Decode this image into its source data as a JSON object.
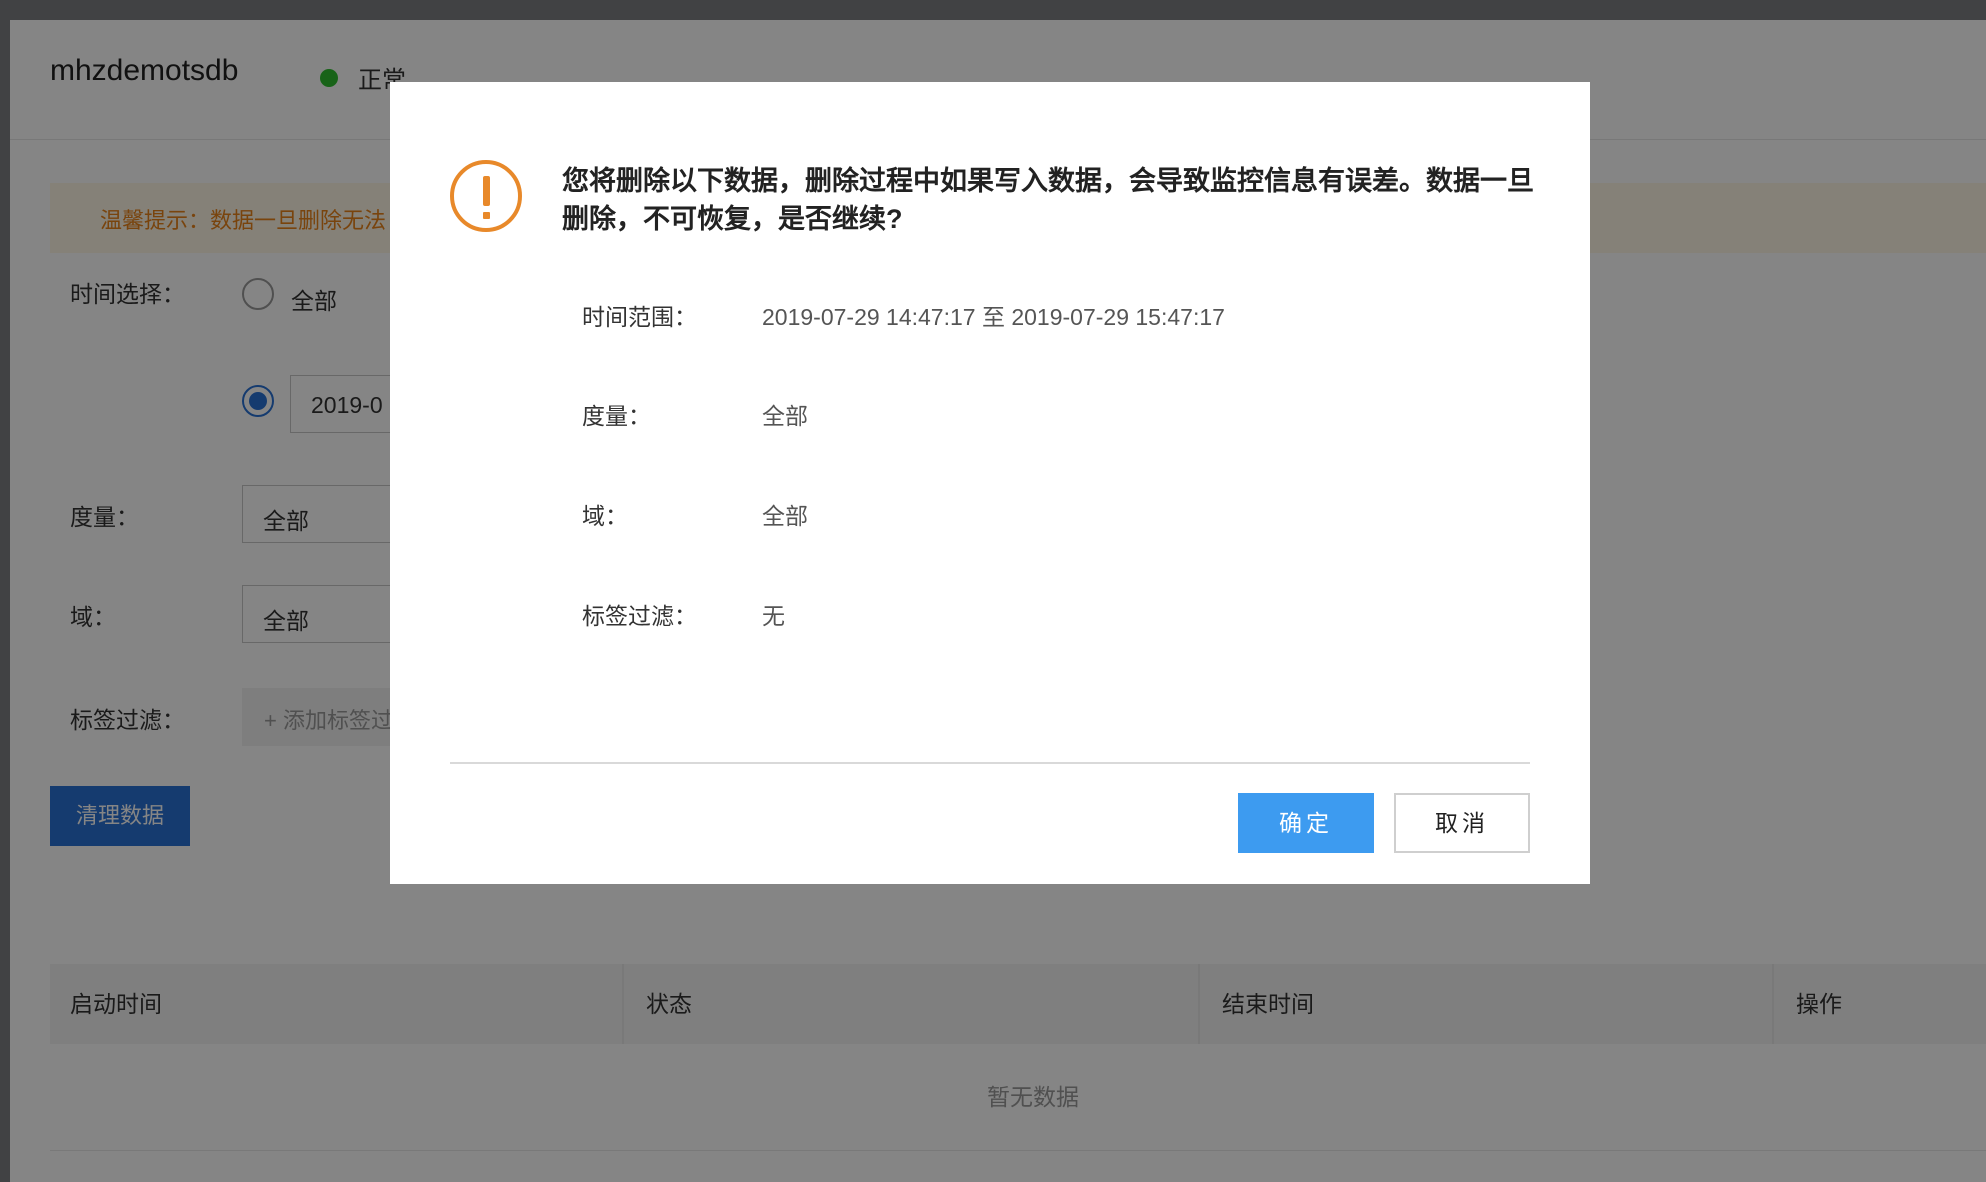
{
  "header": {
    "instance_name": "mhzdemotsdb",
    "status_text": "正常",
    "status_color": "#2ebf2e"
  },
  "tip": {
    "text": "温馨提示：数据一旦删除无法"
  },
  "form": {
    "time_label": "时间选择：",
    "radio_all_label": "全部",
    "range_value": "2019-0",
    "metric_label": "度量：",
    "metric_value": "全部",
    "domain_label": "域：",
    "domain_value": "全部",
    "tag_label": "标签过滤：",
    "tag_add": "+ 添加标签过"
  },
  "clean_button": "清理数据",
  "table": {
    "columns": [
      "启动时间",
      "状态",
      "结束时间",
      "操作"
    ],
    "empty_text": "暂无数据"
  },
  "modal": {
    "message": "您将删除以下数据，删除过程中如果写入数据，会导致监控信息有误差。数据一旦删除，不可恢复，是否继续?",
    "rows": [
      {
        "label": "时间范围：",
        "value": "2019-07-29 14:47:17 至 2019-07-29 15:47:17"
      },
      {
        "label": "度量：",
        "value": "全部"
      },
      {
        "label": "域：",
        "value": "全部"
      },
      {
        "label": "标签过滤：",
        "value": "无"
      }
    ],
    "ok_label": "确定",
    "cancel_label": "取消"
  },
  "colors": {
    "primary": "#2a72d5",
    "ok_button": "#3d9bf0",
    "warning": "#e8892a"
  }
}
